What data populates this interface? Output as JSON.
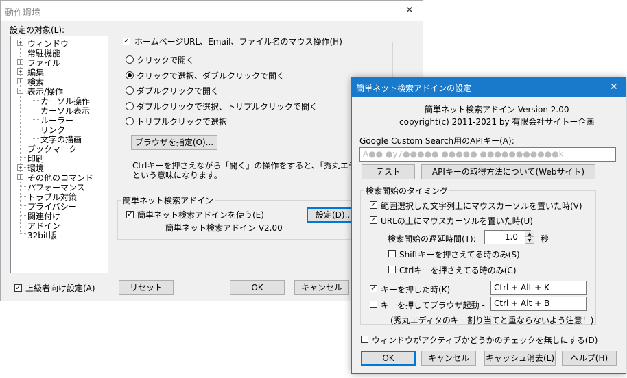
{
  "main_dialog": {
    "title": "動作環境",
    "close_glyph": "✕",
    "target_label": "設定の対象(L):",
    "tree": [
      {
        "label": "ウィンドウ",
        "expander": "+"
      },
      {
        "label": "常駐機能",
        "expander": ""
      },
      {
        "label": "ファイル",
        "expander": "+"
      },
      {
        "label": "編集",
        "expander": "+"
      },
      {
        "label": "検索",
        "expander": "+"
      },
      {
        "label": "表示/操作",
        "expander": "-"
      },
      {
        "label": "カーソル操作",
        "expander": ""
      },
      {
        "label": "カーソル表示",
        "expander": ""
      },
      {
        "label": "ルーラー",
        "expander": ""
      },
      {
        "label": "リンク",
        "expander": ""
      },
      {
        "label": "文字の描画",
        "expander": ""
      },
      {
        "label": "ブックマーク",
        "expander": ""
      },
      {
        "label": "印刷",
        "expander": ""
      },
      {
        "label": "環境",
        "expander": "+"
      },
      {
        "label": "その他のコマンド",
        "expander": "+"
      },
      {
        "label": "パフォーマンス",
        "expander": ""
      },
      {
        "label": "トラブル対策",
        "expander": ""
      },
      {
        "label": "プライバシー",
        "expander": ""
      },
      {
        "label": "関連付け",
        "expander": ""
      },
      {
        "label": "アドイン",
        "expander": ""
      },
      {
        "label": "32bit版",
        "expander": ""
      }
    ],
    "mouse_op_label": "ホームページURL、Email、ファイル名のマウス操作(H)",
    "radios": [
      {
        "label": "クリックで開く",
        "selected": false
      },
      {
        "label": "クリックで選択、ダブルクリックで開く",
        "selected": true
      },
      {
        "label": "ダブルクリックで開く",
        "selected": false
      },
      {
        "label": "ダブルクリックで選択、トリプルクリックで開く",
        "selected": false
      },
      {
        "label": "トリプルクリックで選択",
        "selected": false
      }
    ],
    "browser_button": "ブラウザを指定(O)...",
    "note_line1": "Ctrlキーを押さえながら「開く」の操作をすると、「秀丸エディタで開",
    "note_line2": "という意味になります。",
    "addin_group_title": "簡単ネット検索アドイン",
    "addin_check_label": "簡単ネット検索アドインを使う(E)",
    "addin_version": "簡単ネット検索アドイン V2.00",
    "settings_button": "設定(D)...",
    "advanced_label": "上級者向け設定(A)",
    "reset_button": "リセット",
    "ok_button": "OK",
    "cancel_button": "キャンセル",
    "checkmark": "✓"
  },
  "addin_dialog": {
    "title": "簡単ネット検索アドインの設定",
    "close_glyph": "✕",
    "about_line1": "簡単ネット検索アドイン Version 2.00",
    "about_line2": "copyright(c) 2011-2021 by 有限会社サイトー企画",
    "api_label": "Google Custom Search用のAPIキー(A):",
    "api_value": "A●● ●y7●●●●● ●●●●● ●●●●●●●●●●●k",
    "test_button": "テスト",
    "api_help_button": "APIキーの取得方法について(Webサイト)",
    "timing_group_title": "検索開始のタイミング",
    "check_range": "範囲選択した文字列上にマウスカーソルを置いた時(V)",
    "check_url": "URLの上にマウスカーソルを置いた時(U)",
    "delay_label": "検索開始の遅延時間(T):",
    "delay_value": "1.0",
    "delay_unit": "秒",
    "shift_only": "Shiftキーを押さえてる時のみ(S)",
    "ctrl_only": "Ctrlキーを押さえてる時のみ(C)",
    "key_press_label": "キーを押した時(K) -",
    "key_press_value": "Ctrl + Alt + K",
    "key_browser_label": "キーを押してブラウザ起動 -",
    "key_browser_value": "Ctrl + Alt + B",
    "caution": "(秀丸エディタのキー割り当てと重ならないよう注意！)",
    "active_check_label": "ウィンドウがアクティブかどうかのチェックを無しにする(D)",
    "ok_button": "OK",
    "cancel_button": "キャンセル",
    "clear_cache_button": "キャッシュ消去(L)",
    "help_button": "ヘルプ(H)",
    "checkmark": "✓",
    "titlebar_color": "#1979ca"
  }
}
